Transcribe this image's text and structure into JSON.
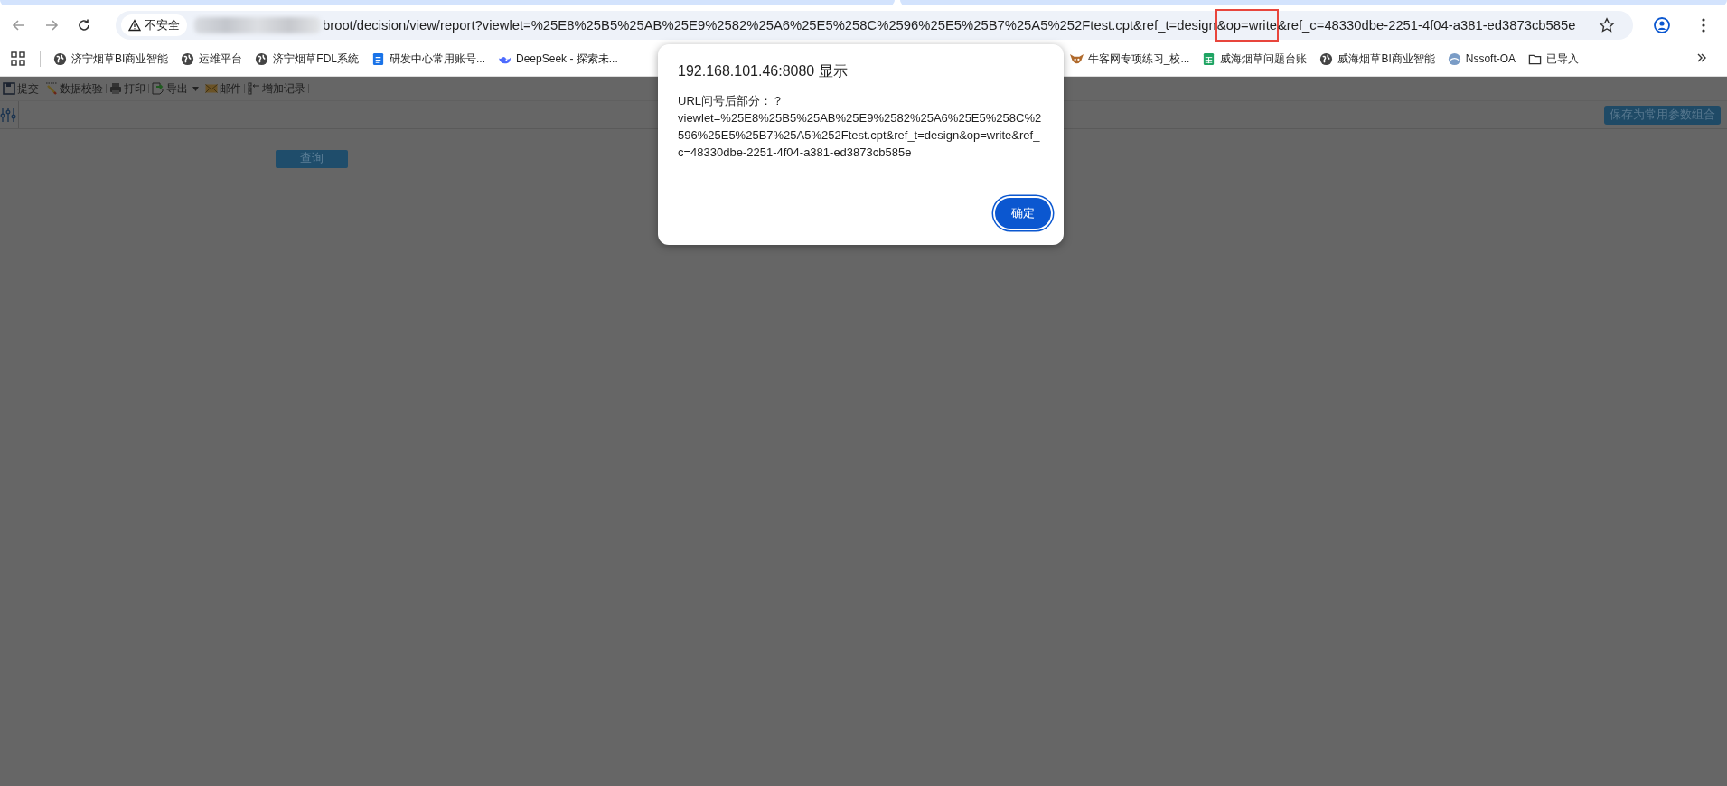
{
  "browser": {
    "security_label": "不安全",
    "url_before": "broot/decision/view/report?viewlet=%25E8%25B5%25AB%25E9%2582%25A6%25E5%258C%2596%25E5%25B7%25A5%252Ftest.cpt&ref_t=design",
    "url_highlighted": "&op=write",
    "url_after": "&ref_c=48330dbe-2251-4f04-a381-ed3873cb585e"
  },
  "bookmarks": [
    {
      "label": "济宁烟草BI商业智能",
      "kind": "globe"
    },
    {
      "label": "运维平台",
      "kind": "globe"
    },
    {
      "label": "济宁烟草FDL系统",
      "kind": "globe"
    },
    {
      "label": "研发中心常用账号...",
      "kind": "doc"
    },
    {
      "label": "DeepSeek - 探索未...",
      "kind": "whale"
    },
    {
      "label": "牛客网专项练习_校...",
      "kind": "niuke"
    },
    {
      "label": "威海烟草问题台账",
      "kind": "sheet"
    },
    {
      "label": "威海烟草BI商业智能",
      "kind": "globe"
    },
    {
      "label": "Nssoft-OA",
      "kind": "nssoft"
    },
    {
      "label": "已导入",
      "kind": "folder"
    }
  ],
  "toolbar": [
    {
      "label": "提交",
      "kind": "save"
    },
    {
      "label": "数据校验",
      "kind": "check"
    },
    {
      "label": "打印",
      "kind": "print"
    },
    {
      "label": "导出",
      "kind": "export"
    },
    {
      "label": "邮件",
      "kind": "mail"
    },
    {
      "label": "增加记录",
      "kind": "add"
    }
  ],
  "query_button": "查询",
  "save_params_button": "保存为常用参数组合",
  "dialog": {
    "title": "192.168.101.46:8080 显示",
    "message": "URL问号后部分：？\nviewlet=%25E8%25B5%25AB%25E9%2582%25A6%25E5%258C%2596%25E5%25B7%25A5%252Ftest.cpt&ref_t=design&op=write&ref_c=48330dbe-2251-4f04-a381-ed3873cb585e",
    "ok": "确定"
  }
}
